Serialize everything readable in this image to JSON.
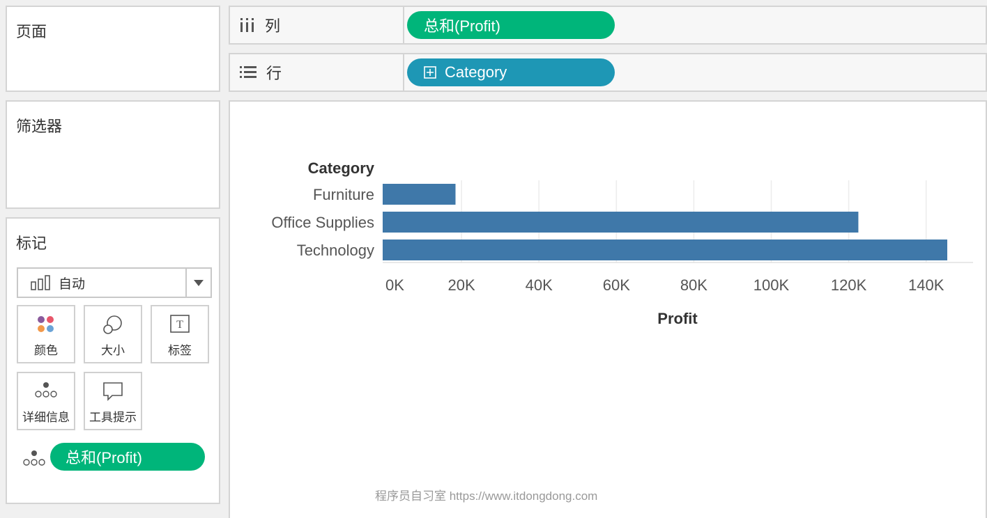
{
  "pages_panel": {
    "title": "页面"
  },
  "filters_panel": {
    "title": "筛选器"
  },
  "marks_panel": {
    "title": "标记",
    "mark_type": "自动",
    "buttons": {
      "color": "颜色",
      "size": "大小",
      "label": "标签",
      "detail": "详细信息",
      "tooltip": "工具提示"
    },
    "field_pill": "总和(Profit)"
  },
  "columns_shelf": {
    "label": "列",
    "pill": "总和(Profit)"
  },
  "rows_shelf": {
    "label": "行",
    "pill": "Category"
  },
  "chart_data": {
    "type": "bar",
    "orientation": "horizontal",
    "row_header": "Category",
    "categories": [
      "Furniture",
      "Office Supplies",
      "Technology"
    ],
    "values": [
      18451,
      122491,
      145455
    ],
    "xlabel": "Profit",
    "xlim": [
      0,
      150000
    ],
    "ticks": [
      0,
      20000,
      40000,
      60000,
      80000,
      100000,
      120000,
      140000
    ],
    "tick_labels": [
      "0K",
      "20K",
      "40K",
      "60K",
      "80K",
      "100K",
      "120K",
      "140K"
    ],
    "bar_color": "#3f78a9",
    "grid": true
  },
  "watermark": "程序员自习室 https://www.itdongdong.com",
  "colors": {
    "green_pill": "#00b57a",
    "blue_pill": "#1e97b5",
    "bar": "#3f78a9"
  }
}
